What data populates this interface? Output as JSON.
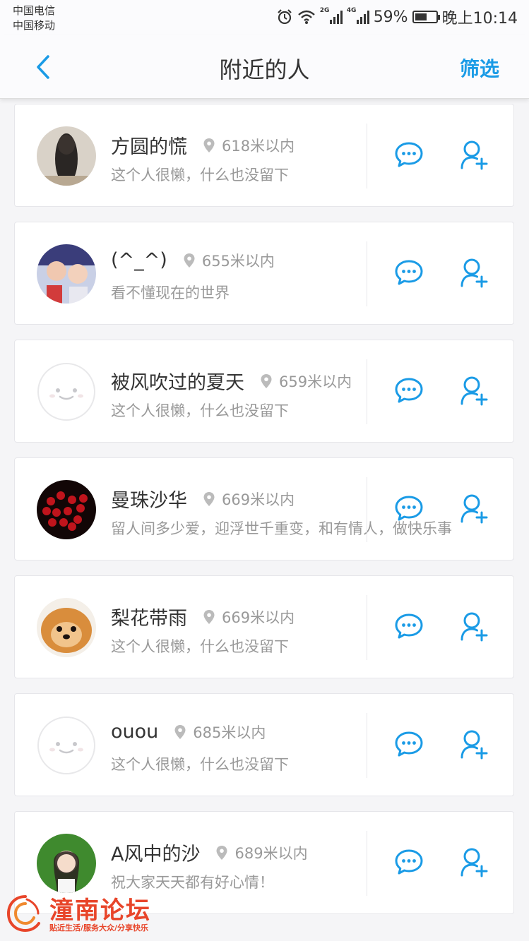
{
  "status_bar": {
    "carrier_1": "中国电信",
    "carrier_2": "中国移动",
    "net_1": "2G",
    "net_2": "4G",
    "battery": "59%",
    "battery_level": 0.59,
    "time": "晚上10:14",
    "icons": [
      "alarm-icon",
      "wifi-icon",
      "signal-icon",
      "battery-icon"
    ]
  },
  "nav": {
    "title": "附近的人",
    "filter_label": "筛选",
    "back_icon": "back-arrow-icon"
  },
  "colors": {
    "accent": "#1a9be6",
    "text": "#333333",
    "muted": "#999999",
    "background": "#f5f5f7",
    "watermark": "#e8452a"
  },
  "people": [
    {
      "name": "方圆的慌",
      "distance": "618米以内",
      "signature": "这个人很懒，什么也没留下",
      "avatar": "photo-long-hair"
    },
    {
      "name": "(^_^)",
      "distance": "655米以内",
      "signature": "看不懂现在的世界",
      "avatar": "photo-kids"
    },
    {
      "name": "被风吹过的夏天",
      "distance": "659米以内",
      "signature": "这个人很懒，什么也没留下",
      "avatar": "default-face"
    },
    {
      "name": "曼珠沙华",
      "distance": "669米以内",
      "signature": "留人间多少爱，迎浮世千重变，和有情人，做快乐事",
      "avatar": "photo-red-flowers"
    },
    {
      "name": "梨花带雨",
      "distance": "669米以内",
      "signature": "这个人很懒，什么也没留下",
      "avatar": "photo-pomeranian"
    },
    {
      "name": "ouou",
      "distance": "685米以内",
      "signature": "这个人很懒，什么也没留下",
      "avatar": "default-face"
    },
    {
      "name": "A风中的沙",
      "distance": "689米以内",
      "signature": "祝大家天天都有好心情！",
      "avatar": "photo-girl-green"
    }
  ],
  "watermark": {
    "title": "潼南论坛",
    "subtitle": "贴近生活/服务大众/分享快乐"
  }
}
